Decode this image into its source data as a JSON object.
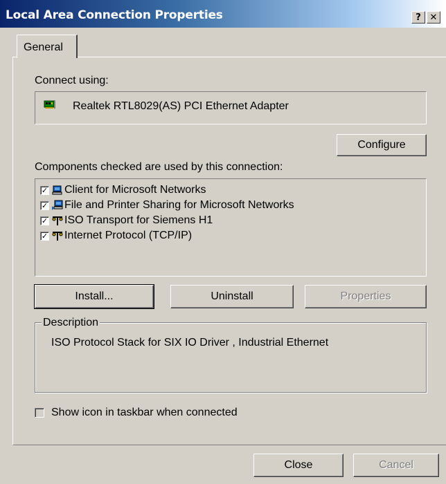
{
  "window": {
    "title": "Local Area Connection Properties",
    "help_button": "?",
    "close_button": "✕"
  },
  "tabs": [
    {
      "label": "General",
      "selected": true
    }
  ],
  "connect_using": {
    "label": "Connect using:",
    "adapter_name": "Realtek RTL8029(AS) PCI Ethernet Adapter",
    "adapter_icon": "network-card-icon"
  },
  "configure_button": "Configure",
  "components": {
    "label": "Components checked are used by this connection:",
    "items": [
      {
        "label": "Client for Microsoft Networks",
        "checked": true,
        "icon": "computer-icon"
      },
      {
        "label": "File and Printer Sharing for Microsoft Networks",
        "checked": true,
        "icon": "sharing-icon"
      },
      {
        "label": "ISO Transport for Siemens H1",
        "checked": true,
        "icon": "protocol-icon"
      },
      {
        "label": "Internet Protocol (TCP/IP)",
        "checked": true,
        "icon": "protocol-icon"
      }
    ]
  },
  "buttons": {
    "install": "Install...",
    "uninstall": "Uninstall",
    "properties": "Properties"
  },
  "description": {
    "legend": "Description",
    "text": "ISO Protocol Stack for SIX IO Driver , Industrial Ethernet"
  },
  "show_icon": {
    "label": "Show icon in taskbar when connected",
    "checked": false
  },
  "footer": {
    "close": "Close",
    "cancel": "Cancel"
  },
  "colors": {
    "title_gradient_start": "#0a246a",
    "title_gradient_end": "#a6caf0",
    "face": "#d4d0c8"
  }
}
